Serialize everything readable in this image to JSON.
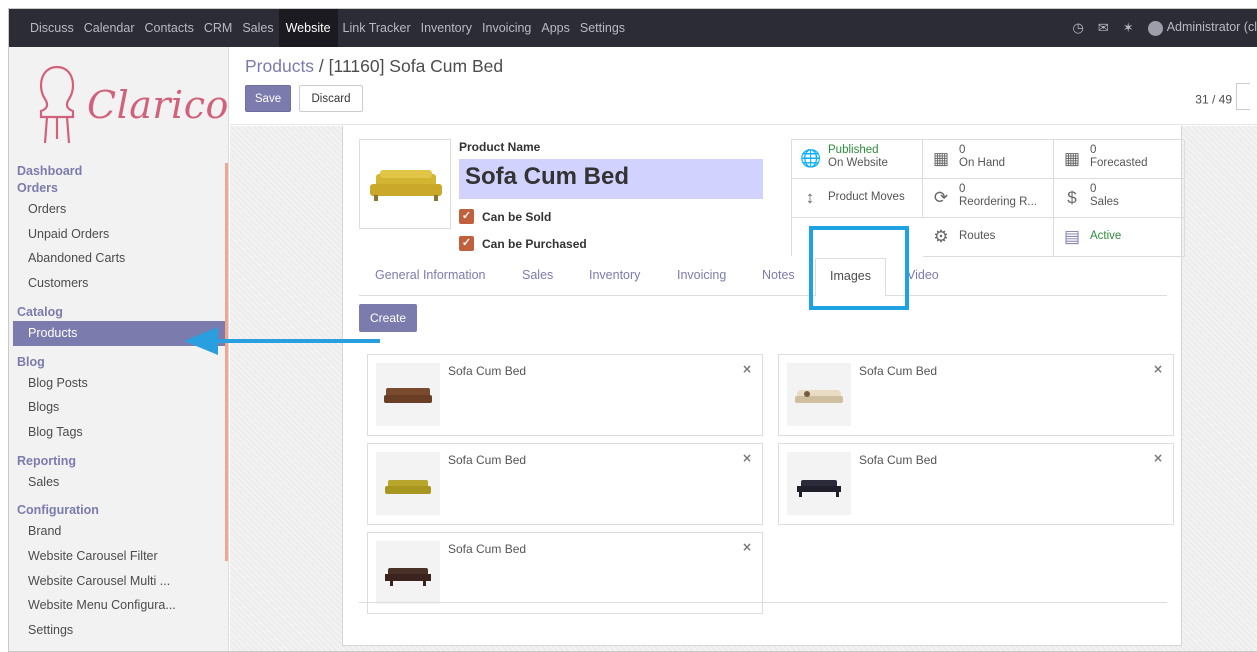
{
  "topbar": {
    "menu": [
      "Discuss",
      "Calendar",
      "Contacts",
      "CRM",
      "Sales",
      "Website",
      "Link Tracker",
      "Inventory",
      "Invoicing",
      "Apps",
      "Settings"
    ],
    "active": "Website",
    "icons": [
      "clock-icon",
      "chat-icon",
      "bug-icon"
    ],
    "user": "Administrator (cl"
  },
  "sidebar": {
    "logo_text": "Clarico",
    "sections": [
      {
        "title": "Dashboard",
        "items": []
      },
      {
        "title": "Orders",
        "items": [
          "Orders",
          "Unpaid Orders",
          "Abandoned Carts",
          "Customers"
        ]
      },
      {
        "title": "Catalog",
        "items": [
          "Products"
        ]
      },
      {
        "title": "Blog",
        "items": [
          "Blog Posts",
          "Blogs",
          "Blog Tags"
        ]
      },
      {
        "title": "Reporting",
        "items": [
          "Sales"
        ]
      },
      {
        "title": "Configuration",
        "items": [
          "Brand",
          "Website Carousel Filter",
          "Website Carousel Multi ...",
          "Website Menu Configura...",
          "Settings"
        ]
      }
    ],
    "active_item": "Products"
  },
  "control": {
    "breadcrumb_parent": "Products",
    "breadcrumb_sep": " / ",
    "breadcrumb_current": "[11160] Sofa Cum Bed",
    "save_label": "Save",
    "discard_label": "Discard",
    "pager": "31 / 49"
  },
  "product": {
    "name_label": "Product Name",
    "name": "Sofa Cum Bed",
    "can_be_sold": "Can be Sold",
    "can_be_purchased": "Can be Purchased",
    "image_color": "#d4b531"
  },
  "stats": {
    "published_1": "Published",
    "published_2": "On Website",
    "onhand_value": "0",
    "onhand_label": "On Hand",
    "forecast_value": "0",
    "forecast_label": "Forecasted",
    "moves_label": "Product Moves",
    "reorder_value": "0",
    "reorder_label": "Reordering R...",
    "sales_value": "0",
    "sales_label": "Sales",
    "routes_label": "Routes",
    "active_label": "Active"
  },
  "tabs": {
    "general": "General Information",
    "sales": "Sales",
    "inventory": "Inventory",
    "invoicing": "Invoicing",
    "notes": "Notes",
    "images": "Images",
    "video": "Video"
  },
  "images_panel": {
    "create_label": "Create",
    "remove_glyph": "×",
    "cards": [
      {
        "name": "Sofa Cum Bed",
        "color": "#7a4a2e"
      },
      {
        "name": "Sofa Cum Bed",
        "color": "#e8dcc4"
      },
      {
        "name": "Sofa Cum Bed",
        "color": "#b7a52c"
      },
      {
        "name": "Sofa Cum Bed",
        "color": "#2a2a3a"
      },
      {
        "name": "Sofa Cum Bed",
        "color": "#4a3128"
      }
    ]
  },
  "colors": {
    "brand": "#7c7bad",
    "highlight": "#1fa3e0",
    "topbar": "#2c2c36"
  }
}
